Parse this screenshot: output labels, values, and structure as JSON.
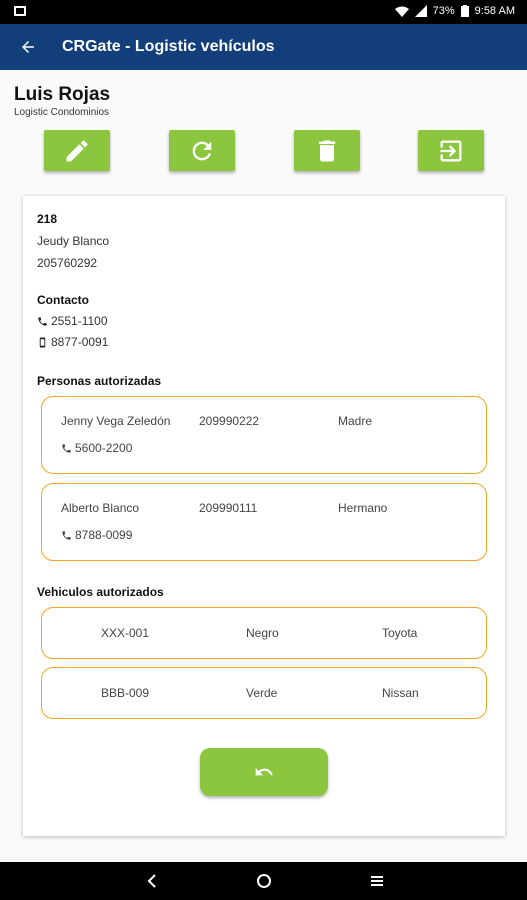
{
  "status_bar": {
    "battery_percent": "73%",
    "time": "9:58 AM",
    "icons": [
      "notification-icon",
      "wifi-icon",
      "signal-icon",
      "battery-icon"
    ]
  },
  "app_bar": {
    "title": "CRGate - Logistic vehículos",
    "back_icon": "back-arrow-icon"
  },
  "user": {
    "name": "Luis Rojas",
    "subtitle": "Logistic Condominios"
  },
  "actions": [
    {
      "icon": "edit-icon"
    },
    {
      "icon": "refresh-icon"
    },
    {
      "icon": "delete-icon"
    },
    {
      "icon": "exit-icon"
    }
  ],
  "unit": {
    "number": "218",
    "owner": "Jeudy Blanco",
    "id": "205760292"
  },
  "contact": {
    "heading": "Contacto",
    "phone": "2551-1100",
    "mobile": "8877-0091"
  },
  "persons": {
    "heading": "Personas autorizadas",
    "items": [
      {
        "name": "Jenny Vega Zeledón",
        "id": "209990222",
        "relation": "Madre",
        "phone": "5600-2200"
      },
      {
        "name": "Alberto Blanco",
        "id": "209990111",
        "relation": "Hermano",
        "phone": "8788-0099"
      }
    ]
  },
  "vehicles": {
    "heading": "Vehiculos autorizados",
    "items": [
      {
        "plate": "XXX-001",
        "color": "Negro",
        "brand": "Toyota"
      },
      {
        "plate": "BBB-009",
        "color": "Verde",
        "brand": "Nissan"
      }
    ]
  },
  "colors": {
    "app_bar": "#123f79",
    "button_green": "#8cc63e",
    "box_border": "#f5a623"
  },
  "return_button": {
    "icon": "undo-icon"
  },
  "nav_bar": {
    "icons": [
      "nav-back-icon",
      "nav-home-icon",
      "nav-menu-icon"
    ]
  }
}
